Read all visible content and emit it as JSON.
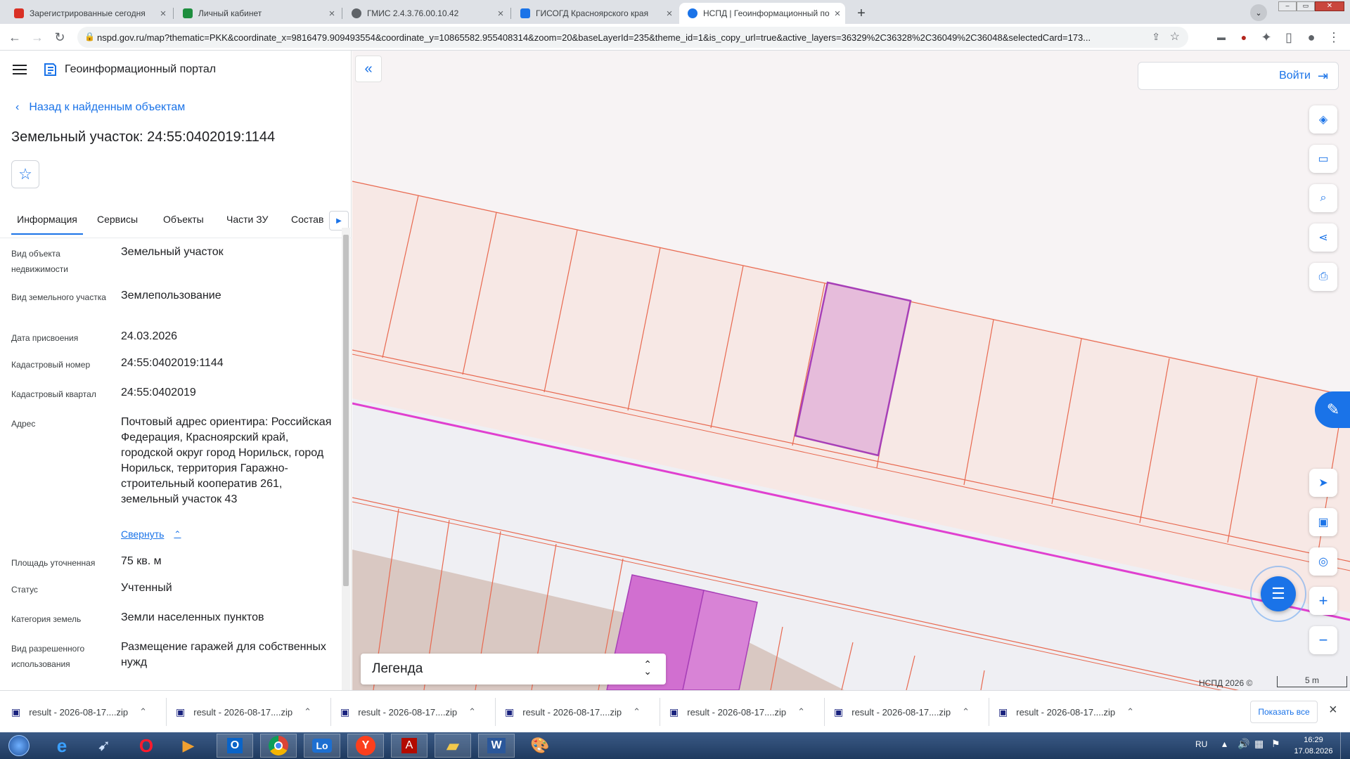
{
  "browser": {
    "tabs": [
      {
        "title": "Зарегистрированные сегодня",
        "favicon_color": "#d93025"
      },
      {
        "title": "Личный кабинет",
        "favicon_color": "#1e8e3e"
      },
      {
        "title": "ГМИС 2.4.3.76.00.10.42",
        "favicon_color": "#5f6368"
      },
      {
        "title": "ГИСОГД Красноярского края",
        "favicon_color": "#1a73e8"
      },
      {
        "title": "НСПД | Геоинформационный по",
        "favicon_color": "#1a73e8"
      }
    ],
    "new_tab_icon": "plus-icon",
    "url": "nspd.gov.ru/map?thematic=PKK&coordinate_x=9816479.909493554&coordinate_y=10865582.955408314&zoom=20&baseLayerId=235&theme_id=1&is_copy_url=true&active_layers=36329%2C36328%2C36049%2C36048&selectedCard=173..."
  },
  "portal": {
    "title": "Геоинформационный портал",
    "back_link": "Назад к найденным объектам",
    "heading": "Земельный участок: 24:55:0402019:1144",
    "tabs": [
      "Информация",
      "Сервисы",
      "Объекты",
      "Части ЗУ",
      "Состав"
    ],
    "fields": [
      {
        "label": "Вид объекта недвижимости",
        "value": "Земельный участок"
      },
      {
        "label": "Вид земельного участка",
        "value": "Землепользование"
      },
      {
        "label": "Дата присвоения",
        "value": "24.03.2026"
      },
      {
        "label": "Кадастровый номер",
        "value": "24:55:0402019:1144"
      },
      {
        "label": "Кадастровый квартал",
        "value": "24:55:0402019"
      },
      {
        "label": "Адрес",
        "value": "Почтовый адрес ориентира: Российская Федерация, Красноярский край, городской округ город Норильск, город Норильск, территория Гаражно-строительный кооператив 261, земельный участок 43"
      },
      {
        "label": "Площадь уточненная",
        "value": "75 кв. м"
      },
      {
        "label": "Статус",
        "value": "Учтенный"
      },
      {
        "label": "Категория земель",
        "value": "Земли населенных пунктов"
      },
      {
        "label": "Вид разрешенного использования",
        "value": "Размещение гаражей для собственных нужд"
      }
    ],
    "collapse_link": "Свернуть"
  },
  "map": {
    "login_label": "Войти",
    "legend_label": "Легенда",
    "copyright": "НСПД 2026 ©",
    "scale_label": "5 m",
    "colors": {
      "parcel_line": "#e8684f",
      "selected": "#a73fb7",
      "highlight": "#d16fd0",
      "road_line": "#e040d0"
    }
  },
  "downloads": {
    "items": [
      "result - 2026-08-17....zip",
      "result - 2026-08-17....zip",
      "result - 2026-08-17....zip",
      "result - 2026-08-17....zip",
      "result - 2026-08-17....zip",
      "result - 2026-08-17....zip",
      "result - 2026-08-17....zip"
    ],
    "show_all": "Показать все"
  },
  "taskbar": {
    "lang": "RU",
    "time": "16:29",
    "date": "17.08.2026"
  }
}
